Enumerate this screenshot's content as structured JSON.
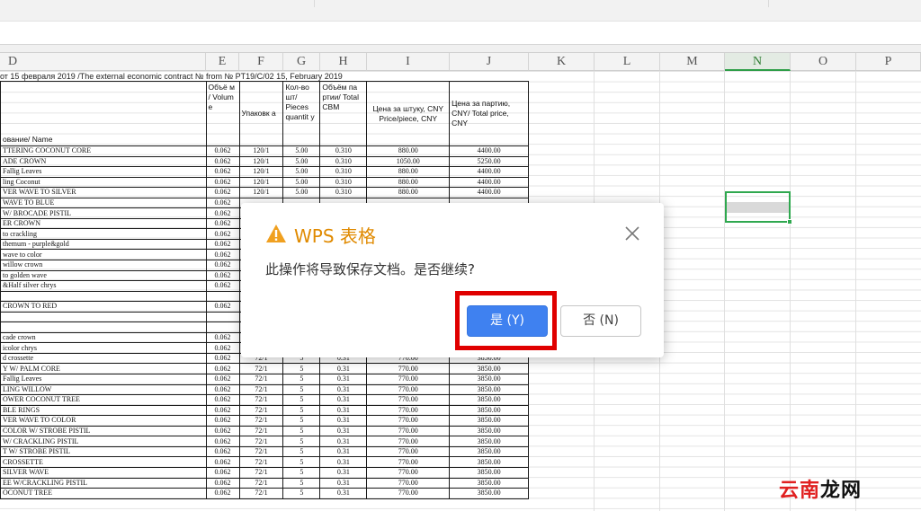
{
  "columns": [
    {
      "id": "D",
      "label": "D"
    },
    {
      "id": "E",
      "label": "E"
    },
    {
      "id": "F",
      "label": "F"
    },
    {
      "id": "G",
      "label": "G"
    },
    {
      "id": "H",
      "label": "H"
    },
    {
      "id": "I",
      "label": "I"
    },
    {
      "id": "J",
      "label": "J"
    },
    {
      "id": "K",
      "label": "K"
    },
    {
      "id": "L",
      "label": "L"
    },
    {
      "id": "M",
      "label": "M"
    },
    {
      "id": "N",
      "label": "N"
    },
    {
      "id": "O",
      "label": "O"
    },
    {
      "id": "P",
      "label": "P"
    }
  ],
  "active_column": "N",
  "sheet": {
    "title_line": "от 15 февраля 2019 /The external economic contract №  from  № PT19/C/02 15, February 2019",
    "headers": {
      "name": "ование/ Name",
      "volume": "Объё м / Volum е",
      "packing": "Упаковк а",
      "pieces": "Кол-во шт/ Pieces quantit y",
      "total_cbm": "Объём па ртии/ Total CBM",
      "price_piece": "Цена за штуку, CNY Price/piece, CNY",
      "total_price": "Цена за партию, CNY/ Total price, CNY"
    },
    "rows": [
      [
        "TTERING  COCONUT    CORE",
        "0.062",
        "120/1",
        "5.00",
        "0.310",
        "880.00",
        "4400.00"
      ],
      [
        "ADE CROWN",
        "0.062",
        "120/1",
        "5.00",
        "0.310",
        "1050.00",
        "5250.00"
      ],
      [
        " Fallig Leaves",
        "0.062",
        "120/1",
        "5.00",
        "0.310",
        "880.00",
        "4400.00"
      ],
      [
        "ling Coconut",
        "0.062",
        "120/1",
        "5.00",
        "0.310",
        "880.00",
        "4400.00"
      ],
      [
        "VER WAVE TO SILVER",
        "0.062",
        "120/1",
        "5.00",
        "0.310",
        "880.00",
        "4400.00"
      ],
      [
        "WAVE TO BLUE",
        "0.062",
        "",
        "",
        "",
        "",
        ""
      ],
      [
        "W/ BROCADE  PISTIL",
        "0.062",
        "",
        "",
        "",
        "",
        ""
      ],
      [
        "ER CROWN",
        "0.062",
        "",
        "",
        "",
        "",
        ""
      ],
      [
        " to crackling",
        "0.062",
        "",
        "",
        "",
        "",
        ""
      ],
      [
        "themum - purple&gold",
        "0.062",
        "",
        "",
        "",
        "",
        ""
      ],
      [
        " wave to color",
        "0.062",
        "",
        "",
        "",
        "",
        ""
      ],
      [
        " willow crown",
        "0.062",
        "",
        "",
        "",
        "",
        ""
      ],
      [
        " to golden wave",
        "0.062",
        "",
        "",
        "",
        "",
        ""
      ],
      [
        "&Half silver chrys",
        "0.062",
        "",
        "",
        "",
        "",
        ""
      ],
      [
        "",
        "",
        "",
        "",
        "",
        "",
        ""
      ],
      [
        " CROWN TO RED",
        "0.062",
        "",
        "",
        "",
        "",
        ""
      ],
      [
        "",
        "",
        "",
        "",
        "",
        "",
        ""
      ],
      [
        "",
        "",
        "",
        "",
        "",
        "",
        ""
      ],
      [
        "cade crown",
        "0.062",
        "",
        "",
        "",
        "",
        ""
      ],
      [
        "icolor chrys",
        "0.062",
        "",
        "",
        "",
        "",
        ""
      ],
      [
        "d crossette",
        "0.062",
        "72/1",
        "5",
        "0.31",
        "770.00",
        "3850.00"
      ],
      [
        "Y  W/ PALM CORE",
        "0.062",
        "72/1",
        "5",
        "0.31",
        "770.00",
        "3850.00"
      ],
      [
        " Fallig Leaves",
        "0.062",
        "72/1",
        "5",
        "0.31",
        "770.00",
        "3850.00"
      ],
      [
        "LING  WILLOW",
        "0.062",
        "72/1",
        "5",
        "0.31",
        "770.00",
        "3850.00"
      ],
      [
        "OWER COCONUT TREE",
        "0.062",
        "72/1",
        "5",
        "0.31",
        "770.00",
        "3850.00"
      ],
      [
        "BLE RINGS",
        "0.062",
        "72/1",
        "5",
        "0.31",
        "770.00",
        "3850.00"
      ],
      [
        "VER WAVE TO COLOR",
        "0.062",
        "72/1",
        "5",
        "0.31",
        "770.00",
        "3850.00"
      ],
      [
        "COLOR W/ STROBE PISTIL",
        "0.062",
        "72/1",
        "5",
        "0.31",
        "770.00",
        "3850.00"
      ],
      [
        "W/ CRACKLING  PISTIL",
        "0.062",
        "72/1",
        "5",
        "0.31",
        "770.00",
        "3850.00"
      ],
      [
        "T  W/ STROBE   PISTIL",
        "0.062",
        "72/1",
        "5",
        "0.31",
        "770.00",
        "3850.00"
      ],
      [
        "CROSSETTE",
        "0.062",
        "72/1",
        "5",
        "0.31",
        "770.00",
        "3850.00"
      ],
      [
        " SILVER WAVE",
        "0.062",
        "72/1",
        "5",
        "0.31",
        "770.00",
        "3850.00"
      ],
      [
        "EE W/CRACKLING  PISTIL",
        "0.062",
        "72/1",
        "5",
        "0.31",
        "770.00",
        "3850.00"
      ],
      [
        "OCONUT TREE",
        "0.062",
        "72/1",
        "5",
        "0.31",
        "770.00",
        "3850.00"
      ]
    ]
  },
  "dialog": {
    "app_title": "WPS 表格",
    "message": "此操作将导致保存文档。是否继续?",
    "yes_label": "是 (Y)",
    "no_label": "否 (N)",
    "warn_color": "#F0A020",
    "primary_color": "#3F81F0",
    "highlight_color": "#E00000",
    "close_icon": "close-icon",
    "warning_icon": "warning-icon"
  },
  "watermark": {
    "part1": "云南",
    "part2": "龙网"
  }
}
